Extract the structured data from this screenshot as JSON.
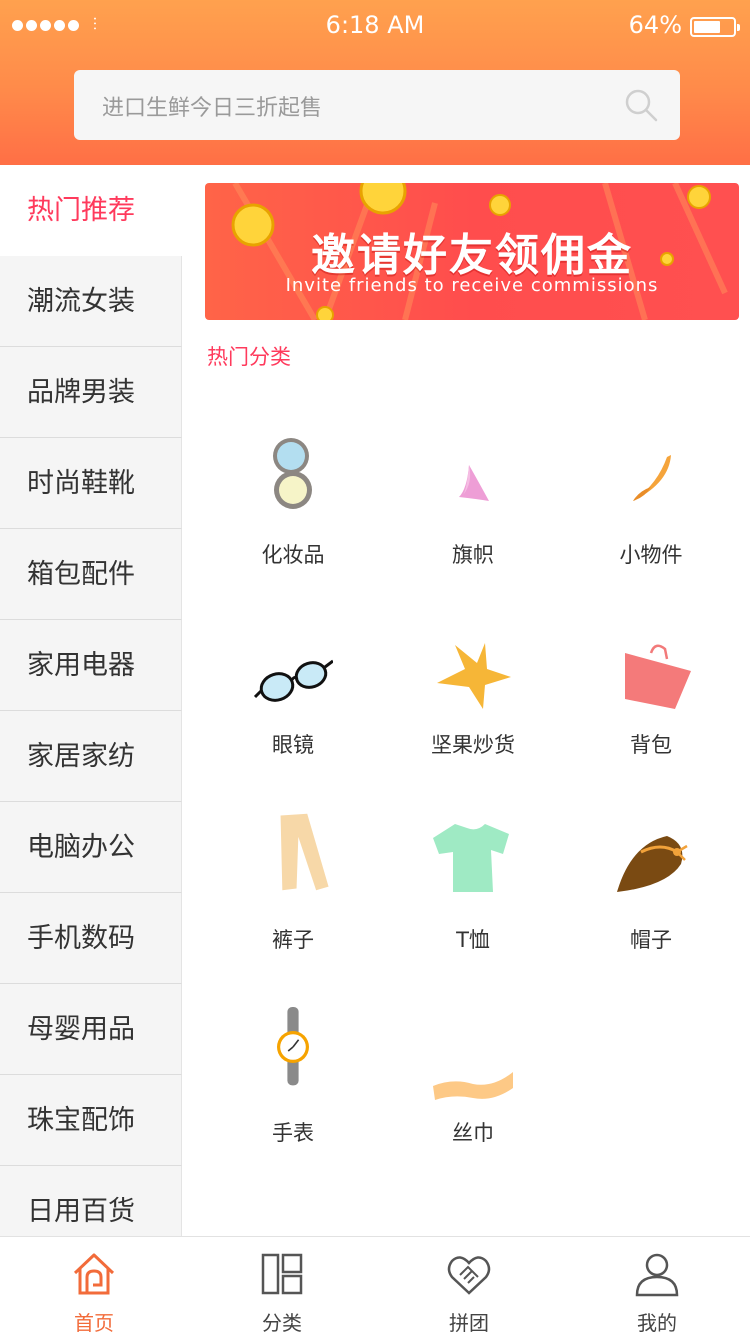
{
  "status_bar": {
    "time": "6:18 AM",
    "battery": "64%",
    "battery_level": 0.64
  },
  "search": {
    "placeholder": "进口生鲜今日三折起售",
    "icon": "search-icon"
  },
  "sidebar": {
    "items": [
      {
        "label": "热门推荐",
        "active": true
      },
      {
        "label": "潮流女装"
      },
      {
        "label": "品牌男装"
      },
      {
        "label": "时尚鞋靴"
      },
      {
        "label": "箱包配件"
      },
      {
        "label": "家用电器"
      },
      {
        "label": "家居家纺"
      },
      {
        "label": "电脑办公"
      },
      {
        "label": "手机数码"
      },
      {
        "label": "母婴用品"
      },
      {
        "label": "珠宝配饰"
      },
      {
        "label": "日用百货"
      }
    ]
  },
  "banner": {
    "title": "邀请好友领佣金",
    "subtitle": "Invite friends to receive commissions"
  },
  "section": {
    "title": "热门分类"
  },
  "categories": [
    {
      "label": "化妆品",
      "icon": "compact-mirror-icon"
    },
    {
      "label": "旗帜",
      "icon": "flag-icon"
    },
    {
      "label": "小物件",
      "icon": "small-item-icon"
    },
    {
      "label": "眼镜",
      "icon": "glasses-icon"
    },
    {
      "label": "坚果炒货",
      "icon": "star-icon"
    },
    {
      "label": "背包",
      "icon": "bag-icon"
    },
    {
      "label": "裤子",
      "icon": "pants-icon"
    },
    {
      "label": "T恤",
      "icon": "tshirt-icon"
    },
    {
      "label": "帽子",
      "icon": "hat-icon"
    },
    {
      "label": "手表",
      "icon": "watch-icon"
    },
    {
      "label": "丝巾",
      "icon": "scarf-icon"
    }
  ],
  "tabbar": {
    "tabs": [
      {
        "label": "首页",
        "icon": "home-icon",
        "active": true
      },
      {
        "label": "分类",
        "icon": "category-icon"
      },
      {
        "label": "拼团",
        "icon": "group-buy-icon"
      },
      {
        "label": "我的",
        "icon": "profile-icon"
      }
    ]
  },
  "colors": {
    "accent": "#ff3a5c",
    "header_top": "#ffa14e",
    "header_bottom": "#ff6f46",
    "tab_active": "#f26b3a"
  }
}
